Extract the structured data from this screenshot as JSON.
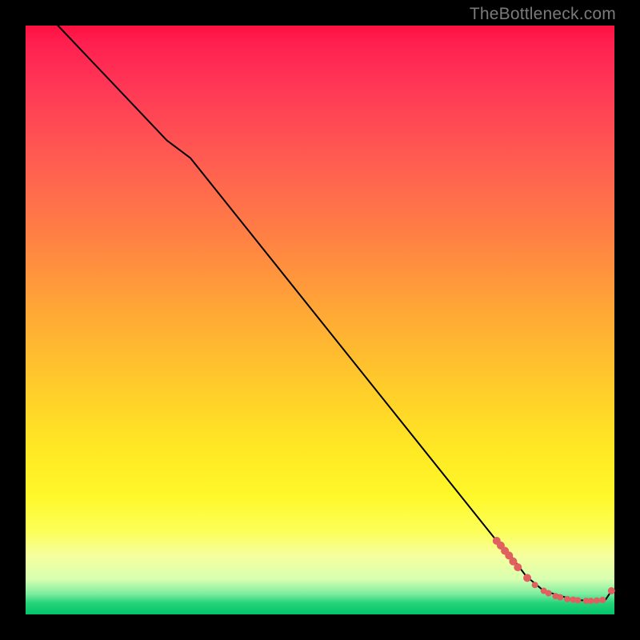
{
  "attribution": "TheBottleneck.com",
  "chart_data": {
    "type": "line",
    "title": "",
    "xlabel": "",
    "ylabel": "",
    "xlim": [
      0,
      100
    ],
    "ylim": [
      0,
      100
    ],
    "series": [
      {
        "name": "curve",
        "x": [
          5.5,
          24,
          28,
          80,
          82,
          85,
          88,
          93,
          96,
          98.5,
          99.5
        ],
        "y": [
          100,
          80.5,
          77.5,
          12.5,
          10.5,
          6.5,
          4,
          2.5,
          2.3,
          2.5,
          4
        ]
      }
    ],
    "markers": {
      "name": "red-dots",
      "color": "#e06060",
      "points": [
        {
          "x": 80.0,
          "y": 12.5,
          "r": 5
        },
        {
          "x": 80.7,
          "y": 11.7,
          "r": 5
        },
        {
          "x": 81.4,
          "y": 10.8,
          "r": 5
        },
        {
          "x": 82.1,
          "y": 10.0,
          "r": 5
        },
        {
          "x": 82.8,
          "y": 9.0,
          "r": 5
        },
        {
          "x": 83.6,
          "y": 8.0,
          "r": 5
        },
        {
          "x": 85.2,
          "y": 6.2,
          "r": 5
        },
        {
          "x": 86.5,
          "y": 5.0,
          "r": 4
        },
        {
          "x": 88.0,
          "y": 4.0,
          "r": 4
        },
        {
          "x": 88.8,
          "y": 3.6,
          "r": 4
        },
        {
          "x": 90.0,
          "y": 3.1,
          "r": 4
        },
        {
          "x": 90.8,
          "y": 2.9,
          "r": 4
        },
        {
          "x": 92.0,
          "y": 2.6,
          "r": 4
        },
        {
          "x": 93.0,
          "y": 2.5,
          "r": 4
        },
        {
          "x": 93.8,
          "y": 2.4,
          "r": 4
        },
        {
          "x": 95.2,
          "y": 2.3,
          "r": 4
        },
        {
          "x": 96.0,
          "y": 2.3,
          "r": 4
        },
        {
          "x": 97.0,
          "y": 2.35,
          "r": 4
        },
        {
          "x": 98.0,
          "y": 2.45,
          "r": 4
        },
        {
          "x": 99.5,
          "y": 4.0,
          "r": 4.5
        }
      ]
    }
  }
}
